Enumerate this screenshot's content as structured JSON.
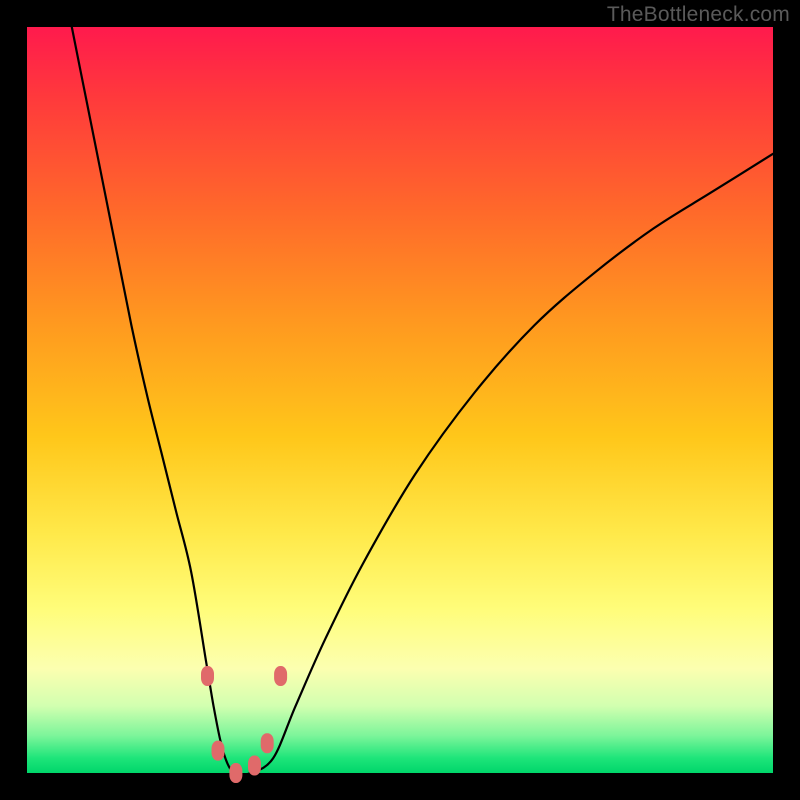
{
  "watermark": "TheBottleneck.com",
  "colors": {
    "background_black": "#000000",
    "gradient_top": "#ff1a4d",
    "gradient_bottom": "#00d66a",
    "curve_stroke": "#000000",
    "marker_fill": "#e06a6a",
    "watermark_text": "#5a5a5a"
  },
  "chart_data": {
    "type": "line",
    "title": "",
    "xlabel": "",
    "ylabel": "",
    "xlim": [
      0,
      100
    ],
    "ylim": [
      0,
      100
    ],
    "annotations": [],
    "series": [
      {
        "name": "curve",
        "x": [
          6,
          8,
          10,
          12,
          14,
          16,
          18,
          20,
          22,
          24,
          25,
          26,
          27,
          28,
          30,
          33,
          36,
          40,
          45,
          52,
          60,
          68,
          76,
          84,
          92,
          100
        ],
        "y": [
          100,
          90,
          80,
          70,
          60,
          51,
          43,
          35,
          27,
          15,
          9,
          4,
          1,
          0,
          0,
          2,
          9,
          18,
          28,
          40,
          51,
          60,
          67,
          73,
          78,
          83
        ]
      }
    ],
    "markers": [
      {
        "x": 24.2,
        "y": 13
      },
      {
        "x": 25.6,
        "y": 3
      },
      {
        "x": 28.0,
        "y": 0
      },
      {
        "x": 30.5,
        "y": 1
      },
      {
        "x": 32.2,
        "y": 4
      },
      {
        "x": 34.0,
        "y": 13
      }
    ],
    "grid": false,
    "legend": false
  }
}
